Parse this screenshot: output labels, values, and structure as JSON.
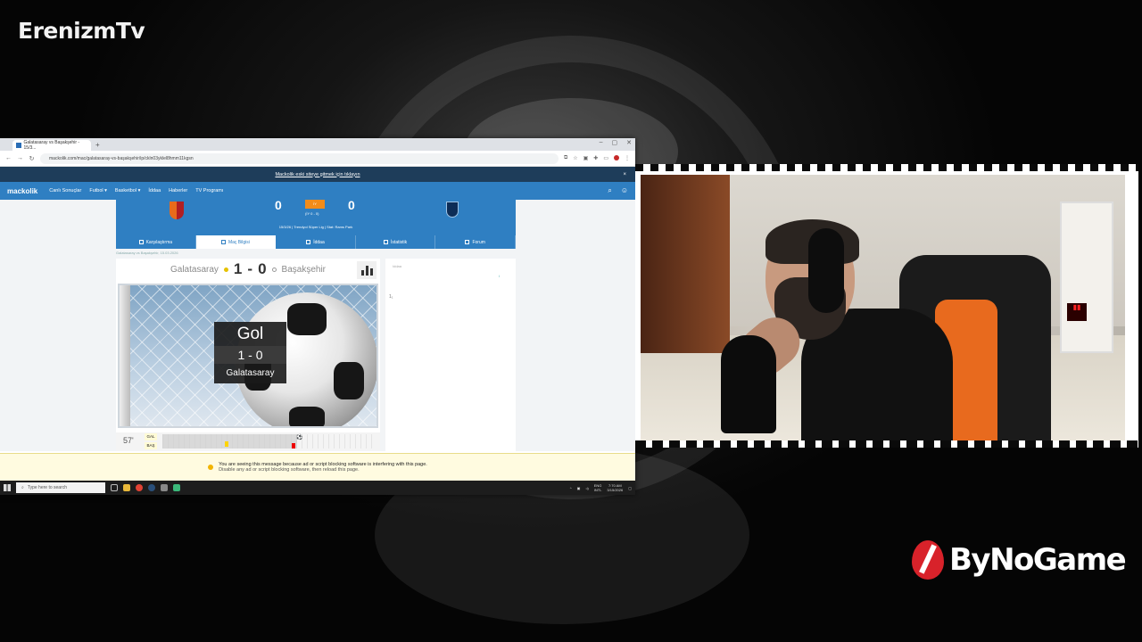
{
  "overlay": {
    "channel_name": "ErenizmTv",
    "sponsor_name": "ByNoGame"
  },
  "browser": {
    "tab_title": "Galatasaray vs Başakşehir - 15/3...",
    "url": "mackolik.com/mac/galatasaray-vs-başakşehir/ip/ckln03yklel8hmm11kgsn",
    "banner_text": "Mackolik eski siteye gitmek için tıklayın",
    "close_glyph": "×"
  },
  "site": {
    "logo": "mackolik",
    "nav": [
      "Canlı Sonuçlar",
      "Futbol",
      "Basketbol",
      "İddaa",
      "Haberler",
      "TV Programı"
    ],
    "header": {
      "home_score": "0",
      "away_score": "0",
      "status": "İY",
      "halftime": "(İY 0 - 0)",
      "info": "15/3/26 | Trendyol Süper Lig | Stat: Rams Park"
    },
    "tabs": [
      "Karşılaştırma",
      "Maç Bilgisi",
      "İddaa",
      "İstatistik",
      "Forum"
    ],
    "active_tab": "Maç Bilgisi",
    "breadcrumb": "Galatasaray vs Başakşehir, 15.03.2026",
    "match": {
      "home": "Galatasaray",
      "away": "Başakşehir",
      "home_goals": "1",
      "away_goals": "0",
      "separator": "-"
    },
    "goal_card": {
      "title": "Gol",
      "score": "1 - 0",
      "team": "Galatasaray"
    },
    "timeline": {
      "minute": "57'",
      "home_abbr": "GAL",
      "away_abbr": "BAŞ",
      "progress": 0.63
    },
    "sidebar": {
      "label": "Iddaa",
      "link": "i",
      "mini": "1₁"
    }
  },
  "adblock_warning": {
    "line1": "You are seeing this message because ad or script blocking software is interfering with this page.",
    "line2": "Disable any ad or script blocking software, then reload this page."
  },
  "taskbar": {
    "search_placeholder": "Type here to search",
    "lang1": "ENG",
    "lang2": "INTL",
    "time": "7:70 AM",
    "date": "3/15/2026"
  },
  "colors": {
    "site_blue": "#2f7fc2",
    "banner_navy": "#1e3d5a",
    "accent_orange": "#f28c1a",
    "brand_red": "#d8222a"
  }
}
